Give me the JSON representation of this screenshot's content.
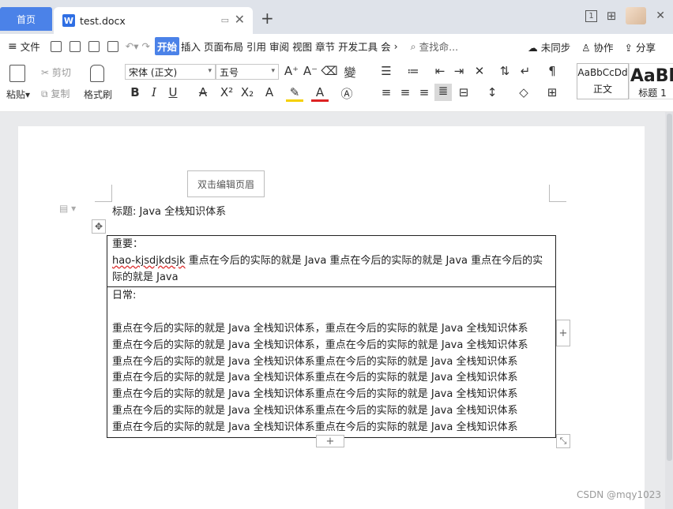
{
  "tabs": {
    "home": "首页",
    "doc_title": "test.docx",
    "pin_icon": "pin-icon",
    "close": "✕",
    "new_tab": "+"
  },
  "window": {
    "layout_badge": "1",
    "grid_icon": "grid-icon",
    "close": "✕"
  },
  "menu": {
    "file": "文件",
    "tabs": [
      "开始",
      "插入",
      "页面布局",
      "引用",
      "审阅",
      "视图",
      "章节",
      "开发工具",
      "会"
    ],
    "active_tab": "开始",
    "search": "查找命...",
    "sync": "未同步",
    "collab": "协作",
    "share": "分享"
  },
  "ribbon": {
    "paste": "粘贴",
    "cut": "剪切",
    "copy": "复制",
    "format_painter": "格式刷",
    "font_name": "宋体 (正文)",
    "font_size": "五号",
    "bold": "B",
    "italic": "I",
    "underline": "U",
    "styles": [
      {
        "preview": "AaBbCcDd",
        "name": "正文"
      },
      {
        "preview": "AaBl",
        "name": "标题 1"
      }
    ],
    "accent": "#4b82e8"
  },
  "document": {
    "header_button": "双击编辑页眉",
    "title_line": "标题: Java  全栈知识体系",
    "table": {
      "important_label": "重要：",
      "important_misspelled": "hao-kjsdjkdsjk",
      "important_text": " 重点在今后的实际的就是 Java 重点在今后的实际的就是 Java 重点在今后的实际的就是 Java",
      "daily_label": "日常:",
      "daily_lines": [
        "重点在今后的实际的就是 Java  全栈知识体系，重点在今后的实际的就是 Java  全栈知识体系",
        "重点在今后的实际的就是 Java  全栈知识体系，重点在今后的实际的就是 Java  全栈知识体系",
        "重点在今后的实际的就是 Java  全栈知识体系重点在今后的实际的就是 Java  全栈知识体系",
        "重点在今后的实际的就是 Java  全栈知识体系重点在今后的实际的就是 Java  全栈知识体系",
        "重点在今后的实际的就是 Java  全栈知识体系重点在今后的实际的就是 Java  全栈知识体系",
        "重点在今后的实际的就是 Java  全栈知识体系重点在今后的实际的就是 Java  全栈知识体系",
        "重点在今后的实际的就是 Java  全栈知识体系重点在今后的实际的就是 Java  全栈知识体系"
      ]
    },
    "add_row": "+",
    "add_col": "+"
  },
  "watermark": "CSDN @mqy1023"
}
